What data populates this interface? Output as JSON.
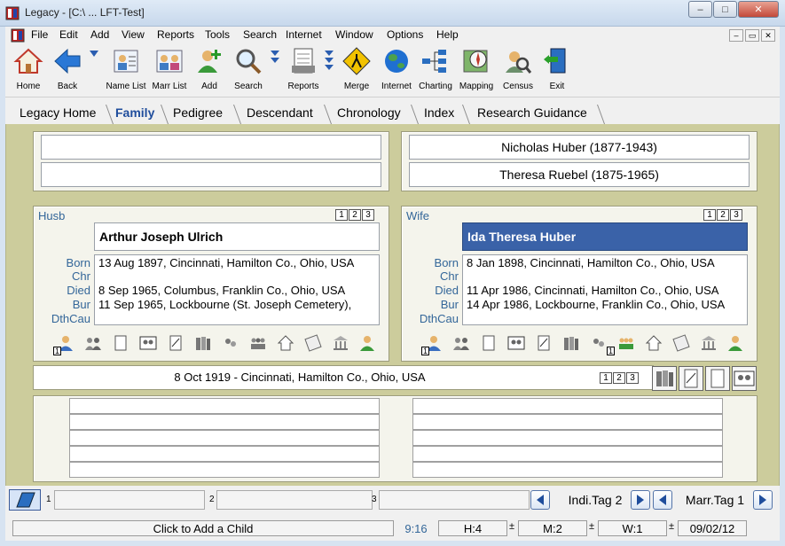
{
  "window": {
    "title": "Legacy - [C:\\ ... LFT-Test]",
    "minimize": "–",
    "maximize": "□",
    "close": "✕"
  },
  "menu": {
    "items": [
      "File",
      "Edit",
      "Add",
      "View",
      "Reports",
      "Tools",
      "Search",
      "Internet",
      "Window",
      "Options",
      "Help"
    ],
    "mdi": [
      "–",
      "▭",
      "✕"
    ]
  },
  "toolbar": {
    "items": [
      "Home",
      "Back",
      "Name List",
      "Marr List",
      "Add",
      "Search",
      "Reports",
      "Merge",
      "Internet",
      "Charting",
      "Mapping",
      "Census",
      "Exit"
    ]
  },
  "tabs": {
    "items": [
      "Legacy Home",
      "Family",
      "Pedigree",
      "Descendant",
      "Chronology",
      "Index",
      "Research Guidance"
    ],
    "active": "Family"
  },
  "parents": {
    "husband_father": "",
    "husband_mother": "",
    "wife_father": "Nicholas Huber (1877-1943)",
    "wife_mother": "Theresa Ruebel (1875-1965)"
  },
  "husband": {
    "header": "Husb",
    "name": "Arthur Joseph Ulrich",
    "selectors": [
      "1",
      "2",
      "3"
    ],
    "labels": [
      "Born",
      "Chr",
      "Died",
      "Bur",
      "DthCau"
    ],
    "values": [
      "13 Aug 1897, Cincinnati, Hamilton Co., Ohio, USA",
      "",
      "8 Sep 1965, Columbus, Franklin Co., Ohio, USA",
      "11 Sep 1965, Lockbourne (St. Joseph Cemetery),",
      ""
    ],
    "count_badge": "1"
  },
  "wife": {
    "header": "Wife",
    "name": "Ida Theresa Huber",
    "selectors": [
      "1",
      "2",
      "3"
    ],
    "labels": [
      "Born",
      "Chr",
      "Died",
      "Bur",
      "DthCau"
    ],
    "values": [
      "8 Jan 1898, Cincinnati, Hamilton Co., Ohio, USA",
      "",
      "11 Apr 1986, Cincinnati, Hamilton Co., Ohio, USA",
      "14 Apr 1986, Lockbourne, Franklin Co., Ohio, USA",
      ""
    ],
    "count_badge": "1",
    "count_badge2": "1"
  },
  "marriage": {
    "text": "8 Oct 1919 - Cincinnati, Hamilton Co., Ohio, USA",
    "selectors": [
      "1",
      "2",
      "3"
    ]
  },
  "children_bar": {
    "slot_numbers": [
      "1",
      "2",
      "3"
    ],
    "indi_tag": "Indi.Tag 2",
    "marr_tag": "Marr.Tag 1"
  },
  "status": {
    "hint": "Click to Add a Child",
    "time": "9:16",
    "h": "H:4",
    "m": "M:2",
    "w": "W:1",
    "date": "09/02/12"
  },
  "colors": {
    "main_bg": "#cccc9c",
    "selected": "#3a62a8",
    "label": "#336699"
  }
}
